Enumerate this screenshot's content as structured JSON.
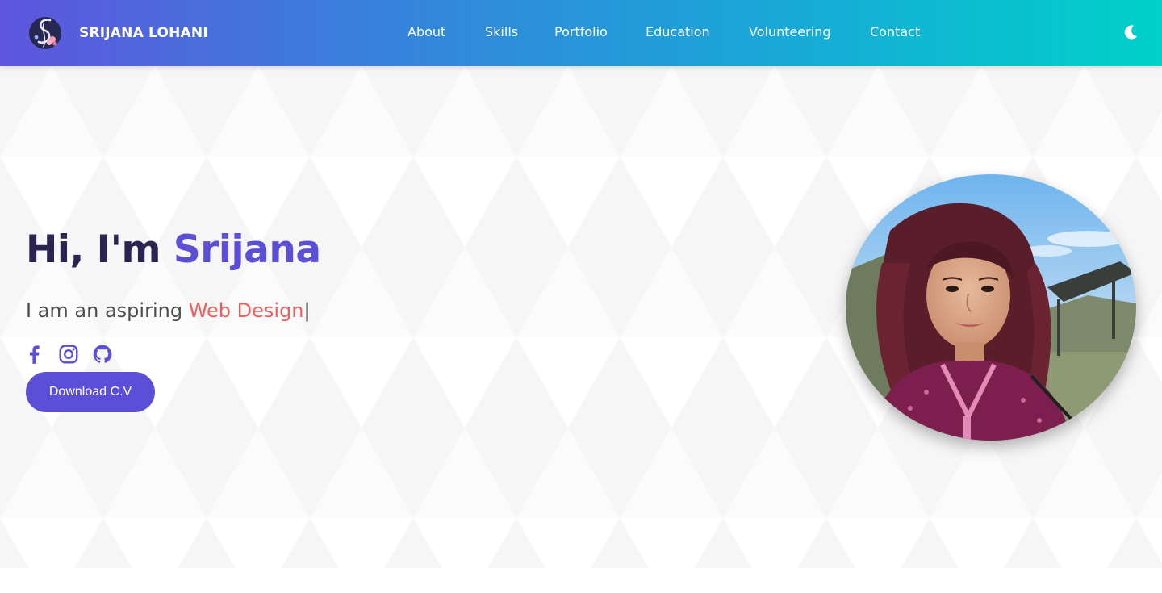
{
  "nav": {
    "brand": "SRIJANA LOHANI",
    "links": [
      "About",
      "Skills",
      "Portfolio",
      "Education",
      "Volunteering",
      "Contact"
    ],
    "theme_icon": "moon-icon"
  },
  "hero": {
    "greeting": "Hi, I'm ",
    "name": "Srijana",
    "subtitle_prefix": "I am an aspiring ",
    "typed_text": "Web Design",
    "caret": "|",
    "socials": [
      "facebook-icon",
      "instagram-icon",
      "github-icon"
    ],
    "cv_button": "Download C.V",
    "photo": "profile-photo"
  },
  "colors": {
    "nav_gradient_start": "#5e55dd",
    "nav_gradient_end": "#00d1c9",
    "accent": "#5b4fd8",
    "typed": "#f25c5c",
    "title": "#2a2550"
  }
}
